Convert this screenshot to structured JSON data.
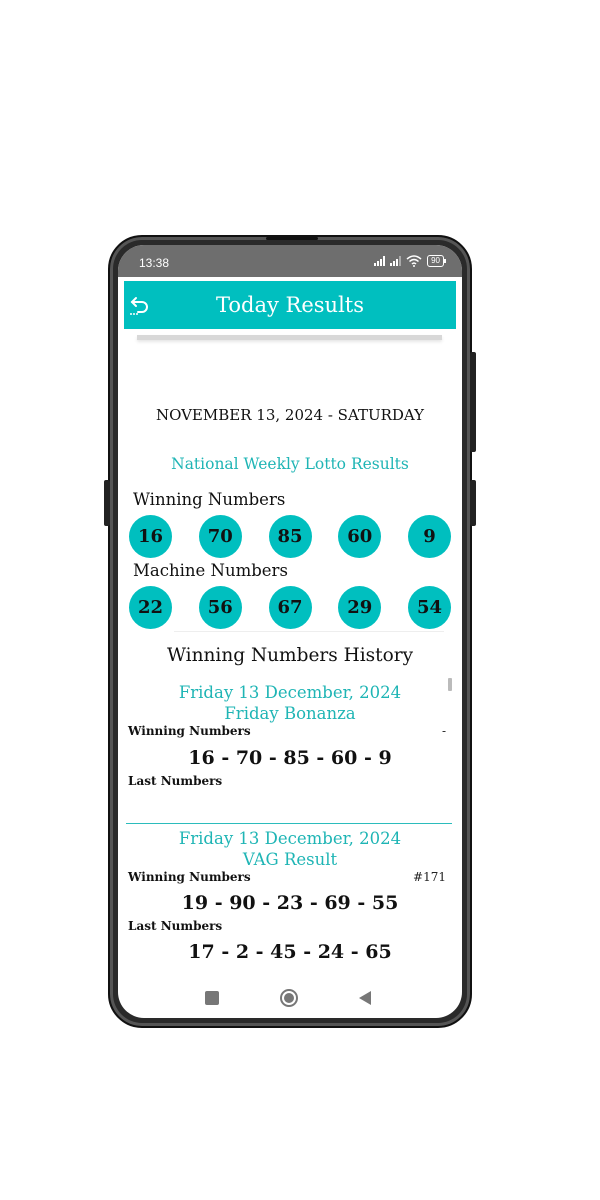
{
  "status_bar": {
    "time": "13:38",
    "battery": "90",
    "icons": [
      "signal-icon",
      "signal-icon",
      "wifi-icon",
      "battery-icon"
    ]
  },
  "app_bar": {
    "title": "Today Results",
    "back_icon": "back-arrow-icon",
    "color": "#00bfbf"
  },
  "today": {
    "date": "NOVEMBER 13, 2024 - SATURDAY",
    "lotto_name": "National Weekly Lotto Results",
    "winning_label": "Winning Numbers",
    "winning_numbers": [
      "16",
      "70",
      "85",
      "60",
      "9"
    ],
    "machine_label": "Machine Numbers",
    "machine_numbers": [
      "22",
      "56",
      "67",
      "29",
      "54"
    ]
  },
  "history": {
    "title": "Winning Numbers History",
    "entries": [
      {
        "date": "Friday 13 December, 2024",
        "name": "Friday Bonanza",
        "winning_label": "Winning Numbers",
        "draw_number": "-",
        "winning_numbers": "16 - 70 - 85 - 60 - 9",
        "last_label": "Last Numbers",
        "last_numbers": ""
      },
      {
        "date": "Friday 13 December, 2024",
        "name": "VAG Result",
        "winning_label": "Winning Numbers",
        "draw_number": "#171",
        "winning_numbers": "19 - 90 - 23 - 69 - 55",
        "last_label": "Last Numbers",
        "last_numbers": "17 - 2 - 45 - 24 - 65"
      }
    ]
  },
  "nav_bar": {
    "icons": [
      "recent-apps-icon",
      "home-icon",
      "back-icon"
    ]
  }
}
